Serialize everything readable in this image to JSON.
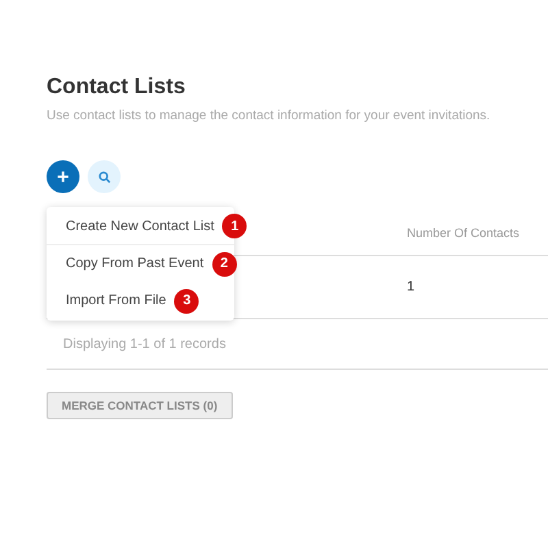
{
  "page": {
    "title": "Contact Lists",
    "subtitle": "Use contact lists to manage the contact information for your event invitations."
  },
  "toolbar": {
    "add_button": "+"
  },
  "menu": {
    "items": [
      {
        "label": "Create New Contact List",
        "marker": "1"
      },
      {
        "label": "Copy From Past Event",
        "marker": "2"
      },
      {
        "label": "Import From File",
        "marker": "3"
      }
    ]
  },
  "table": {
    "columns": [
      "Number Of Contacts"
    ],
    "rows": [
      [
        "1"
      ]
    ]
  },
  "pagination": "Displaying 1-1 of 1 records",
  "merge_button": "MERGE CONTACT LISTS (0)"
}
